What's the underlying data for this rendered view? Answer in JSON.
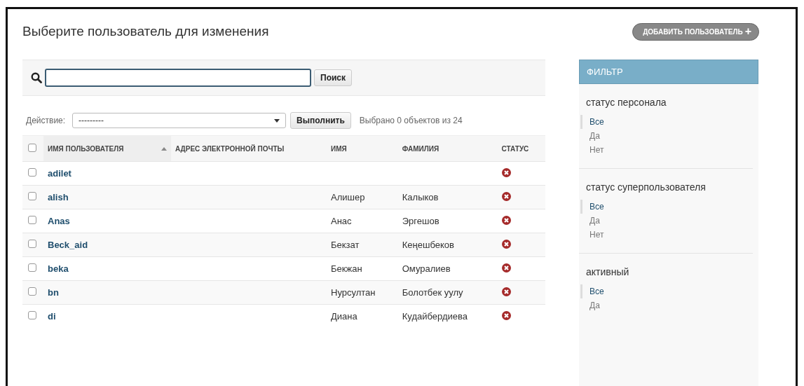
{
  "title": "Выберите пользователь для изменения",
  "add_button": {
    "label": "ДОБАВИТЬ ПОЛЬЗОВАТЕЛЬ",
    "icon": "+"
  },
  "search": {
    "button": "Поиск"
  },
  "actions": {
    "label": "Действие:",
    "select_value": "---------",
    "button": "Выполнить",
    "counter": "Выбрано 0 объектов из 24"
  },
  "table": {
    "select_all_checked": false,
    "columns": [
      {
        "label": "ИМЯ ПОЛЬЗОВАТЕЛЯ",
        "sorted": true
      },
      {
        "label": "АДРЕС ЭЛЕКТРОННОЙ ПОЧТЫ",
        "sorted": false
      },
      {
        "label": "ИМЯ",
        "sorted": false
      },
      {
        "label": "ФАМИЛИЯ",
        "sorted": false
      },
      {
        "label": "СТАТУС",
        "sorted": false
      }
    ],
    "rows": [
      {
        "checked": false,
        "username": "adilet",
        "staff": false
      },
      {
        "checked": false,
        "username": "alish",
        "first_name": "Алишер",
        "last_name": "Калыков",
        "staff": false
      },
      {
        "checked": false,
        "username": "Anas",
        "first_name": "Анас",
        "last_name": "Эргешов",
        "staff": false
      },
      {
        "checked": false,
        "username": "Beck_aid",
        "first_name": "Бекзат",
        "last_name": "Кеңешбеков",
        "staff": false
      },
      {
        "checked": false,
        "username": "beka",
        "first_name": "Бекжан",
        "last_name": "Омуралиев",
        "staff": false
      },
      {
        "checked": false,
        "username": "bn",
        "first_name": "Нурсултан",
        "last_name": "Болотбек уулу",
        "staff": false
      },
      {
        "checked": false,
        "username": "di",
        "first_name": "Диана",
        "last_name": "Кудайбердиева",
        "staff": false
      }
    ]
  },
  "filter": {
    "title": "ФИЛЬТР",
    "groups": [
      {
        "title": "статус персонала",
        "choices": [
          {
            "label": "Все",
            "selected": true
          },
          {
            "label": "Да",
            "selected": false
          },
          {
            "label": "Нет",
            "selected": false
          }
        ]
      },
      {
        "title": "статус суперпользователя",
        "choices": [
          {
            "label": "Все",
            "selected": true
          },
          {
            "label": "Да",
            "selected": false
          },
          {
            "label": "Нет",
            "selected": false
          }
        ]
      },
      {
        "title": "активный",
        "choices": [
          {
            "label": "Все",
            "selected": true
          },
          {
            "label": "Да",
            "selected": false
          }
        ]
      }
    ]
  }
}
